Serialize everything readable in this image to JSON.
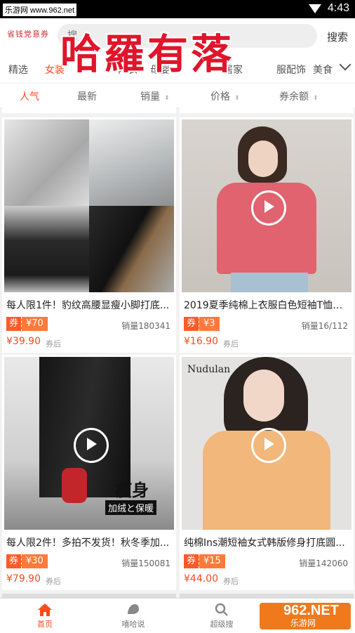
{
  "status_bar": {
    "watermark": "乐游网 www.962.net",
    "time": "4:43"
  },
  "header": {
    "logo_text": "省钱党意券",
    "search_placeholder": "搜",
    "search_button": "搜索"
  },
  "overlay_title": "哈羅有落",
  "categories": [
    "精选",
    "女装",
    "内衣",
    "母婴",
    "居家",
    "服配饰",
    "美食"
  ],
  "categories_active": "女装",
  "sort_options": [
    {
      "label": "人气",
      "active": true,
      "arrows": false
    },
    {
      "label": "最新",
      "active": false,
      "arrows": false
    },
    {
      "label": "销量",
      "active": false,
      "arrows": true
    },
    {
      "label": "价格",
      "active": false,
      "arrows": true
    },
    {
      "label": "券余额",
      "active": false,
      "arrows": true
    }
  ],
  "products": [
    {
      "title": "每人限1件！豹纹高腰显瘦小脚打底...",
      "coupon_label": "券",
      "coupon_value": "¥70",
      "sales": "销量180341",
      "price": "¥39.90",
      "after": "券后",
      "video": false
    },
    {
      "title": "2019夏季纯棉上衣服白色短袖T恤女...",
      "coupon_label": "券",
      "coupon_value": "¥3",
      "sales": "销量16/112",
      "price": "¥16.90",
      "after": "券后",
      "video": true
    },
    {
      "title": "每人限2件！多拍不发货！秋冬季加...",
      "coupon_label": "券",
      "coupon_value": "¥30",
      "sales": "销量150081",
      "price": "¥79.90",
      "after": "券后",
      "video": true,
      "img_text_1": "瘦身",
      "img_text_2": "加绒と保暖"
    },
    {
      "title": "纯棉Ins潮短袖女式韩版修身打底圆...",
      "coupon_label": "券",
      "coupon_value": "¥15",
      "sales": "销量142060",
      "price": "¥44.00",
      "after": "券后",
      "video": true,
      "img_text_1": "Nudulan"
    }
  ],
  "tabbar": [
    {
      "label": "首页",
      "active": true
    },
    {
      "label": "嘻哈说",
      "active": false
    },
    {
      "label": "超级搜",
      "active": false
    }
  ],
  "site_watermark": {
    "number": "962.NET",
    "sub": "乐游网"
  },
  "colors": {
    "accent": "#ff4a1a",
    "coupon": "#ff5a28"
  }
}
